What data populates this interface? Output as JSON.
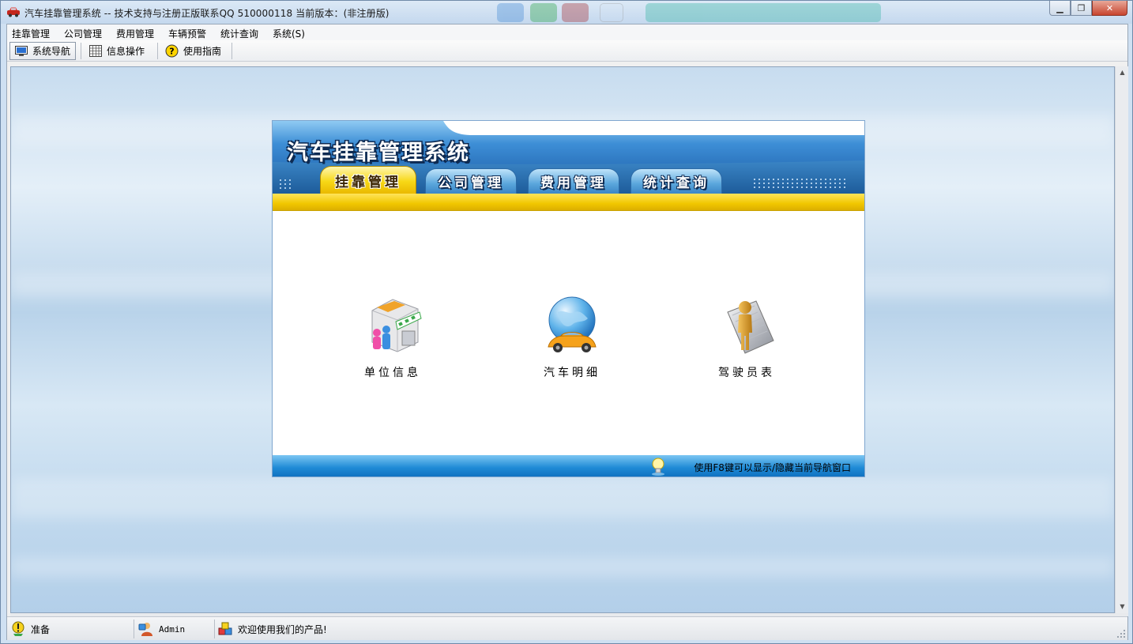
{
  "window": {
    "title": "汽车挂靠管理系统 -- 技术支持与注册正版联系QQ 510000118    当前版本：(非注册版)",
    "controls": [
      "minimize",
      "maximize",
      "close"
    ]
  },
  "menu": {
    "items": [
      "挂靠管理",
      "公司管理",
      "费用管理",
      "车辆预警",
      "统计查询",
      "系统(S)"
    ]
  },
  "toolbar": {
    "buttons": [
      {
        "label": "系统导航",
        "icon": "monitor-icon"
      },
      {
        "label": "信息操作",
        "icon": "grid-icon"
      },
      {
        "label": "使用指南",
        "icon": "help-icon"
      }
    ]
  },
  "nav_panel": {
    "banner_title": "汽车挂靠管理系统",
    "tabs": [
      "挂靠管理",
      "公司管理",
      "费用管理",
      "统计查询"
    ],
    "active_tab": "挂靠管理",
    "entries": [
      {
        "label": "单位信息",
        "icon": "shop-building-icon"
      },
      {
        "label": "汽车明细",
        "icon": "globe-car-icon"
      },
      {
        "label": "驾驶员表",
        "icon": "driver-person-icon"
      }
    ],
    "footer_hint": "使用F8键可以显示/隐藏当前导航窗口"
  },
  "statusbar": {
    "status": "准备",
    "user": "Admin",
    "message": "欢迎使用我们的产品!"
  },
  "colors": {
    "banner_blue": "#2f7fcf",
    "tab_yellow": "#f7d816",
    "footer_blue": "#1f8ad6"
  }
}
